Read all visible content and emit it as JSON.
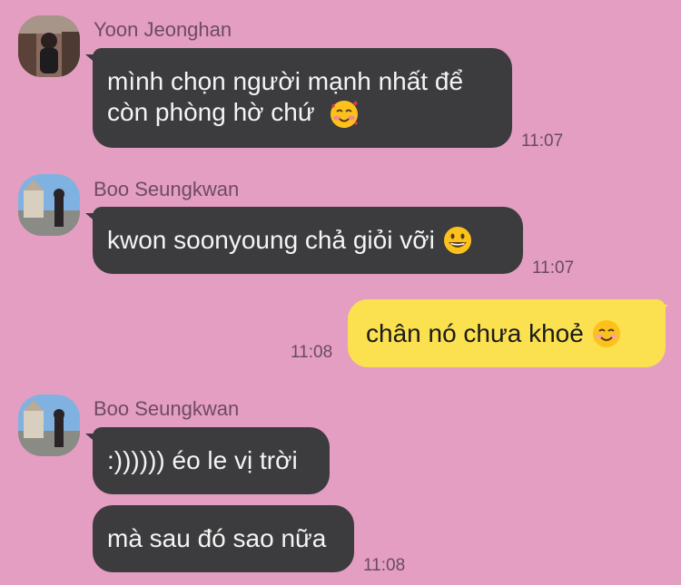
{
  "messages": [
    {
      "sender": "Yoon Jeonghan",
      "lines": [
        "mình chọn người mạnh nhất để",
        "còn phòng hờ chứ"
      ],
      "emoji": "smiling-face-with-hearts-emoji",
      "time": "11:07"
    },
    {
      "sender": "Boo Seungkwan",
      "text": "kwon soonyoung chả giỏi vỡi",
      "emoji": "grinning-face-emoji",
      "time": "11:07"
    },
    {
      "sender": "me",
      "text": "chân nó chưa khoẻ",
      "emoji": "smiling-face-emoji",
      "time": "11:08"
    },
    {
      "sender": "Boo Seungkwan",
      "texts": [
        ":)))))) éo le vị trời",
        "mà sau đó sao nữa"
      ],
      "time": "11:08"
    }
  ],
  "colors": {
    "background": "#e49ec2",
    "incoming_bubble": "#3c3c3e",
    "outgoing_bubble": "#fbe04f",
    "meta_text": "#6e4b62"
  }
}
